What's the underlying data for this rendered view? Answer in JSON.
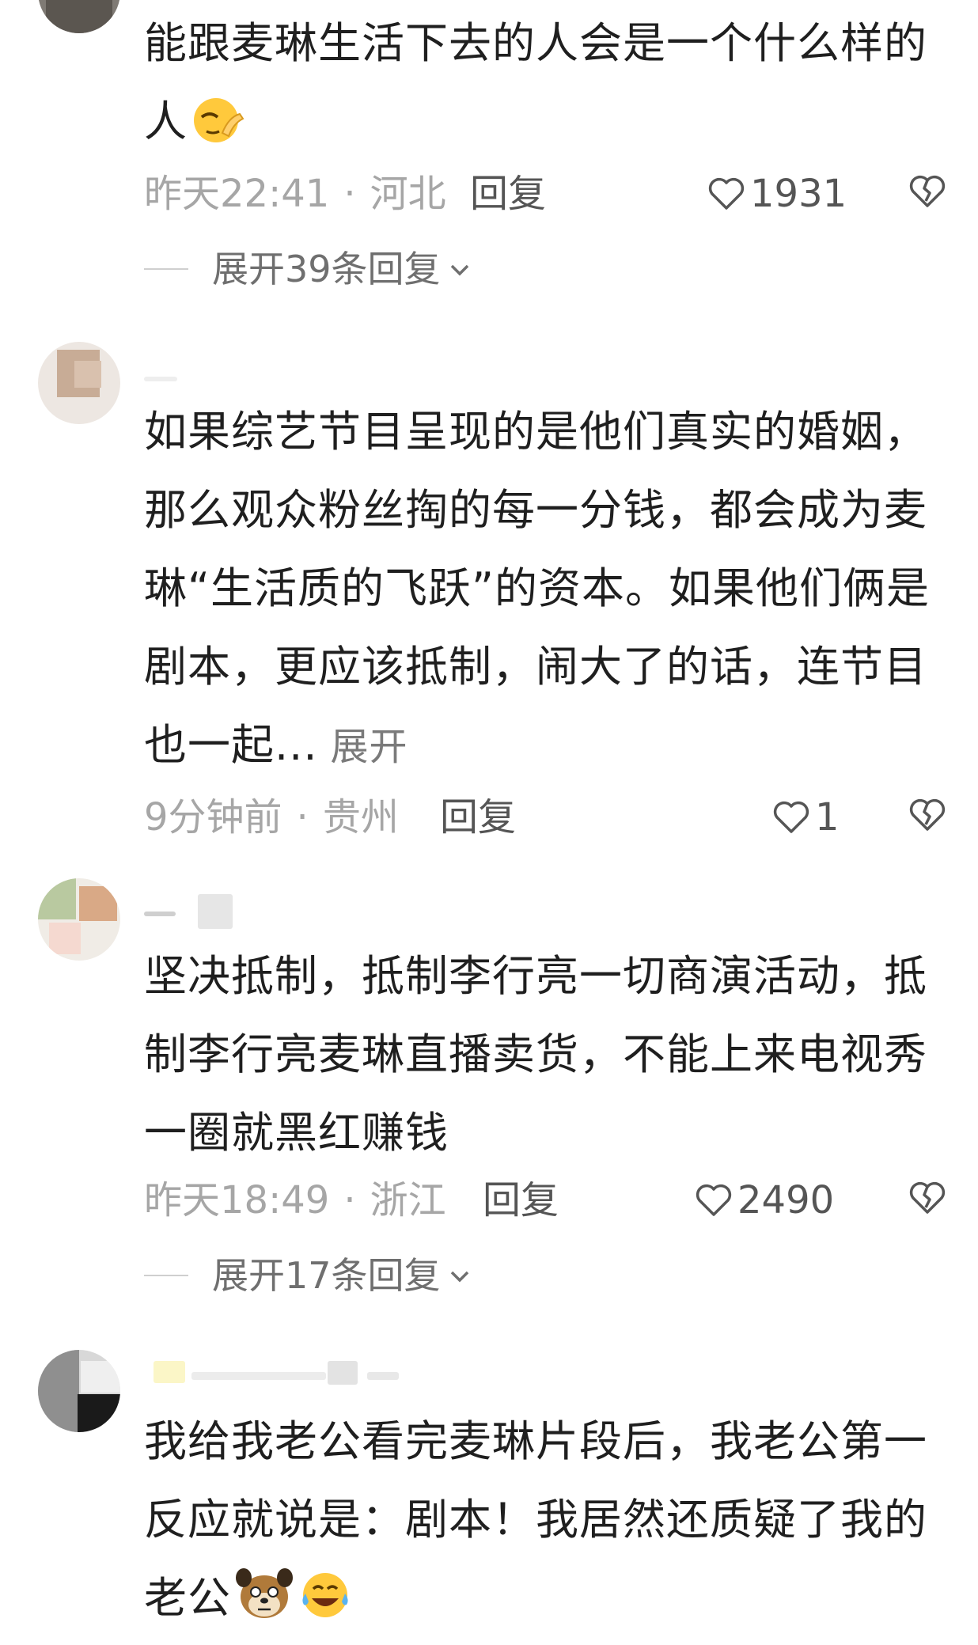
{
  "comments": [
    {
      "text": "能跟麦琳生活下去的人会是一个什么样的人",
      "time": "昨天22:41",
      "location": "河北",
      "reply_label": "回复",
      "likes": "1931",
      "expand": "展开39条回复"
    },
    {
      "text": "如果综艺节目呈现的是他们真实的婚姻，那么观众粉丝掏的每一分钱，都会成为麦琳“生活质的飞跃”的资本。如果他们俩是剧本，更应该抵制，闹大了的话，连节目也一起...",
      "more_label": "展开",
      "time": "9分钟前",
      "location": "贵州",
      "reply_label": "回复",
      "likes": "1"
    },
    {
      "text": "坚决抵制，抵制李行亮一切商演活动，抵制李行亮麦琳直播卖货，不能上来电视秀一圈就黑红赚钱",
      "time": "昨天18:49",
      "location": "浙江",
      "reply_label": "回复",
      "likes": "2490",
      "expand": "展开17条回复"
    },
    {
      "text": "我给我老公看完麦琳片段后，我老公第一反应就说是：剧本！我居然还质疑了我的老公"
    }
  ],
  "separator_dot": "·",
  "colors": {
    "text": "#1f1f1f",
    "meta": "#a6a6a6",
    "action": "#555555",
    "emoji_yellow": "#ffc93c"
  },
  "icons": [
    "heart-outline-icon",
    "broken-heart-icon",
    "chevron-down-icon",
    "facepalm-emoji",
    "dog-emoji",
    "laughing-crying-emoji"
  ]
}
